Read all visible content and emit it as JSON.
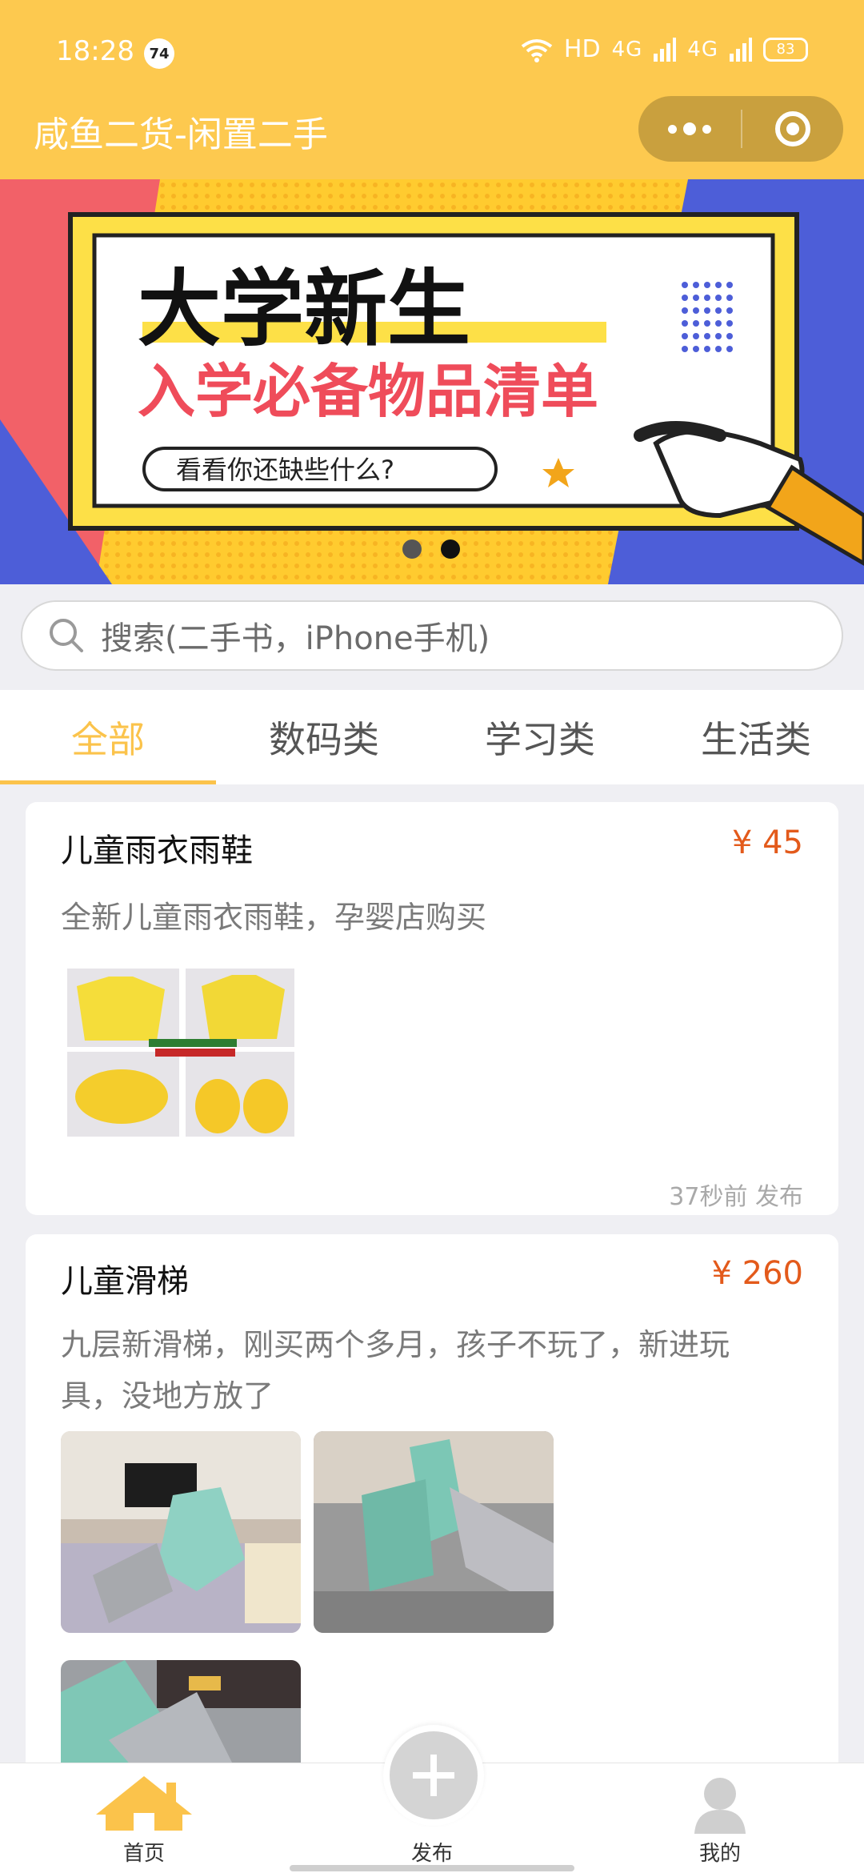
{
  "status_bar": {
    "time": "18:28",
    "badge": "74",
    "network": "HD",
    "signal1": "4G",
    "signal2": "4G",
    "battery": "83"
  },
  "header": {
    "title": "咸鱼二货-闲置二手"
  },
  "banner": {
    "headline": "大学新生",
    "subheadline": "入学必备物品清单",
    "tagline": "看看你还缺些什么?",
    "slide_count": 2,
    "active_slide": 2
  },
  "search": {
    "placeholder": "搜索(二手书，iPhone手机)"
  },
  "tabs": [
    {
      "label": "全部",
      "active": true
    },
    {
      "label": "数码类",
      "active": false
    },
    {
      "label": "学习类",
      "active": false
    },
    {
      "label": "生活类",
      "active": false
    }
  ],
  "listings": [
    {
      "title": "儿童雨衣雨鞋",
      "price": "¥ 45",
      "description": "全新儿童雨衣雨鞋，孕婴店购买",
      "posted": "37秒前 发布",
      "image_count": 1
    },
    {
      "title": "儿童滑梯",
      "price": "¥ 260",
      "description": "九层新滑梯，刚买两个多月，孩子不玩了，新进玩具，没地方放了",
      "image_count": 3
    }
  ],
  "bottom_nav": {
    "home": "首页",
    "publish": "发布",
    "mine": "我的"
  },
  "colors": {
    "brand": "#fdc94f",
    "tab_active": "#fbc34b",
    "price": "#e35a1b"
  }
}
